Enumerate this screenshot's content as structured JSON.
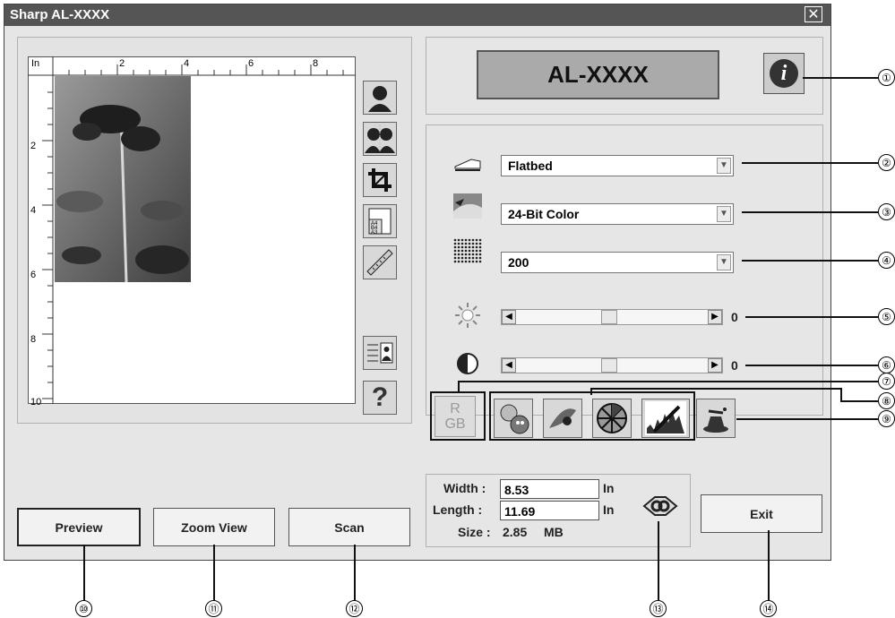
{
  "window": {
    "title": "Sharp AL-XXXX",
    "close_glyph": "✕"
  },
  "ruler": {
    "unit": "In",
    "h_labels": [
      "2",
      "4",
      "6",
      "8"
    ],
    "v_labels": [
      "2",
      "4",
      "6",
      "8",
      "10"
    ]
  },
  "header": {
    "model": "AL-XXXX",
    "info_glyph": "i"
  },
  "settings": {
    "source": "Flatbed",
    "color_mode": "24-Bit Color",
    "resolution": "200",
    "brightness": "0",
    "contrast": "0"
  },
  "rgb_button": {
    "line1": "R",
    "line2": "GB"
  },
  "size": {
    "width_label": "Width :",
    "width_value": "8.53",
    "length_label": "Length :",
    "length_value": "11.69",
    "unit": "In",
    "size_label": "Size :",
    "size_value": "2.85",
    "size_unit": "MB"
  },
  "buttons": {
    "preview": "Preview",
    "zoom_view": "Zoom View",
    "scan": "Scan",
    "exit": "Exit",
    "help_glyph": "?"
  },
  "callouts": [
    "①",
    "②",
    "③",
    "④",
    "⑤",
    "⑥",
    "⑦",
    "⑧",
    "⑨",
    "⑩",
    "⑪",
    "⑫",
    "⑬",
    "⑭"
  ],
  "icons": [
    "person-icon",
    "two-persons-icon",
    "crop-icon",
    "paper-size-icon",
    "ruler-icon",
    "profile-icon",
    "help-icon",
    "info-icon",
    "scanner-icon",
    "color-mode-icon",
    "resolution-icon",
    "brightness-icon",
    "contrast-icon",
    "rgb-icon",
    "descreen-icon",
    "auto-enhance-icon",
    "color-balance-icon",
    "histogram-icon",
    "magic-hat-icon",
    "link-icon"
  ]
}
